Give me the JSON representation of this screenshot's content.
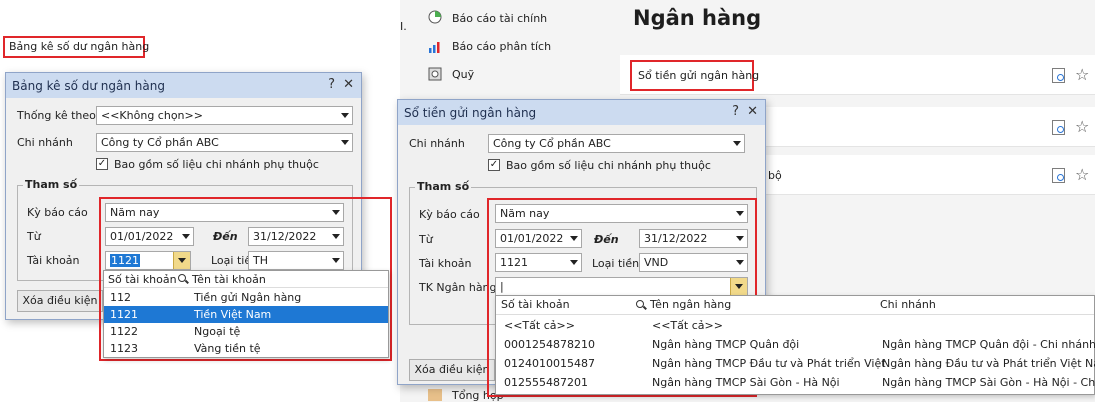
{
  "left": {
    "report_link": "Bảng kê số dư ngân hàng",
    "dialog": {
      "title": "Bảng kê số dư ngân hàng",
      "help": "?",
      "close": "✕",
      "thong_ke_label": "Thống kê theo",
      "thong_ke_value": "<<Không chọn>>",
      "chi_nhanh_label": "Chi nhánh",
      "chi_nhanh_value": "Công ty Cổ phần ABC",
      "include_label": "Bao gồm số liệu chi nhánh phụ thuộc",
      "include_checked": "✓",
      "group_label": "Tham số",
      "ky_label": "Kỳ báo cáo",
      "ky_value": "Năm nay",
      "tu_label": "Từ",
      "tu_value": "01/01/2022",
      "den_label": "Đến",
      "den_value": "31/12/2022",
      "tai_khoan_label": "Tài khoản",
      "tai_khoan_value": "1121",
      "loai_tien_label": "Loại tiền",
      "loai_tien_value": "TH",
      "clear_button": "Xóa điều kiện"
    },
    "dropdown": {
      "col1": "Số tài khoản",
      "col2": "Tên tài khoản",
      "rows": [
        {
          "code": "112",
          "name": "Tiền gửi Ngân hàng"
        },
        {
          "code": "1121",
          "name": "Tiền Việt Nam"
        },
        {
          "code": "1122",
          "name": "Ngoại tệ"
        },
        {
          "code": "1123",
          "name": "Vàng tiền tệ"
        }
      ]
    }
  },
  "right": {
    "menu": [
      {
        "label": "Báo cáo tài chính"
      },
      {
        "label": "Báo cáo phân tích"
      },
      {
        "label": "Quỹ"
      },
      {
        "label": "Tổng hợp"
      }
    ],
    "page_title": "Ngân hàng",
    "card1_label": "Sổ tiền gửi ngân hàng",
    "card3_fragment": "bộ",
    "top_fragment": "I.",
    "dialog": {
      "title": "Sổ tiền gửi ngân hàng",
      "help": "?",
      "close": "✕",
      "chi_nhanh_label": "Chi nhánh",
      "chi_nhanh_value": "Công ty Cổ phần ABC",
      "include_label": "Bao gồm số liệu chi nhánh phụ thuộc",
      "include_checked": "✓",
      "group_label": "Tham số",
      "ky_label": "Kỳ báo cáo",
      "ky_value": "Năm nay",
      "tu_label": "Từ",
      "tu_value": "01/01/2022",
      "den_label": "Đến",
      "den_value": "31/12/2022",
      "tai_khoan_label": "Tài khoản",
      "tai_khoan_value": "1121",
      "loai_tien_label": "Loại tiền",
      "loai_tien_value": "VND",
      "tk_ngan_hang_label": "TK Ngân hàng",
      "tk_ngan_hang_value": "|",
      "clear_button": "Xóa điều kiện"
    },
    "dropdown": {
      "col1": "Số tài khoản",
      "col2": "Tên ngân hàng",
      "col3": "Chi nhánh",
      "rows": [
        {
          "acct": "<<Tất cả>>",
          "bank": "<<Tất cả>>",
          "branch": ""
        },
        {
          "acct": "0001254878210",
          "bank": "Ngân hàng TMCP Quân đội",
          "branch": "Ngân hàng TMCP Quân đội - Chi nhánh"
        },
        {
          "acct": "0124010015487",
          "bank": "Ngân hàng TMCP Đầu tư và Phát triển Việt",
          "branch": "Ngân hàng Đầu tư và Phát triển Việt Na"
        },
        {
          "acct": "012555487201",
          "bank": "Ngân hàng TMCP  Sài Gòn - Hà Nội",
          "branch": "Ngân hàng TMCP  Sài Gòn - Hà Nội - Ch"
        }
      ]
    }
  },
  "colors": {
    "highlight_red": "#e0262a",
    "selection_blue": "#1e78d4",
    "titlebar": "#ccdbf0"
  }
}
